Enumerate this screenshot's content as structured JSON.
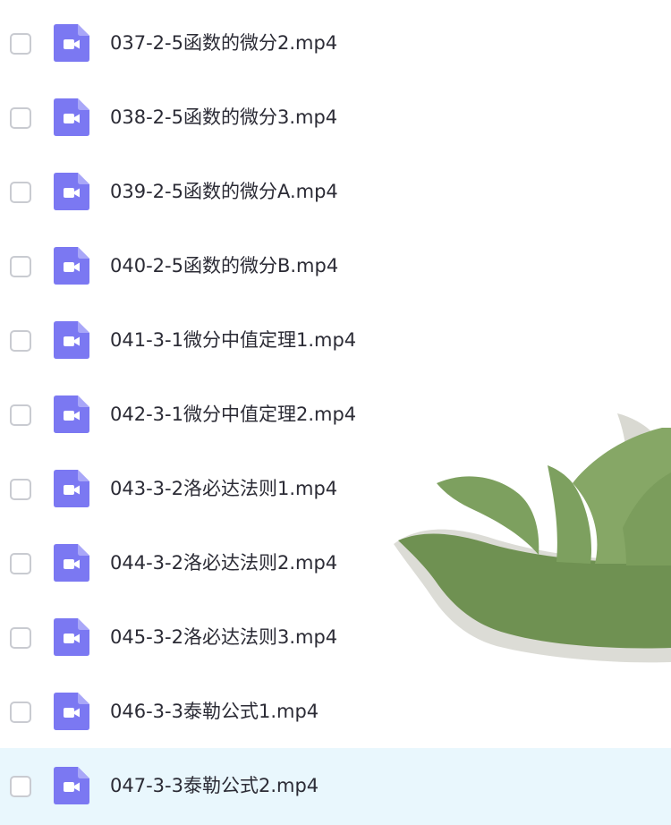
{
  "files": [
    {
      "name": "037-2-5函数的微分2.mp4",
      "selected": false
    },
    {
      "name": "038-2-5函数的微分3.mp4",
      "selected": false
    },
    {
      "name": "039-2-5函数的微分A.mp4",
      "selected": false
    },
    {
      "name": "040-2-5函数的微分B.mp4",
      "selected": false
    },
    {
      "name": "041-3-1微分中值定理1.mp4",
      "selected": false
    },
    {
      "name": "042-3-1微分中值定理2.mp4",
      "selected": false
    },
    {
      "name": "043-3-2洛必达法则1.mp4",
      "selected": false
    },
    {
      "name": "044-3-2洛必达法则2.mp4",
      "selected": false
    },
    {
      "name": "045-3-2洛必达法则3.mp4",
      "selected": false
    },
    {
      "name": "046-3-3泰勒公式1.mp4",
      "selected": false
    },
    {
      "name": "047-3-3泰勒公式2.mp4",
      "selected": false
    }
  ],
  "icons": {
    "file_type": "video-file-icon",
    "decoration": "leaf-decoration"
  },
  "colors": {
    "icon_purple": "#7b78f2",
    "selected_row_bg": "#e9f7fd",
    "text": "#2b2b35",
    "checkbox_border": "#c9cbd1",
    "leaf_green": "#7da05f"
  }
}
